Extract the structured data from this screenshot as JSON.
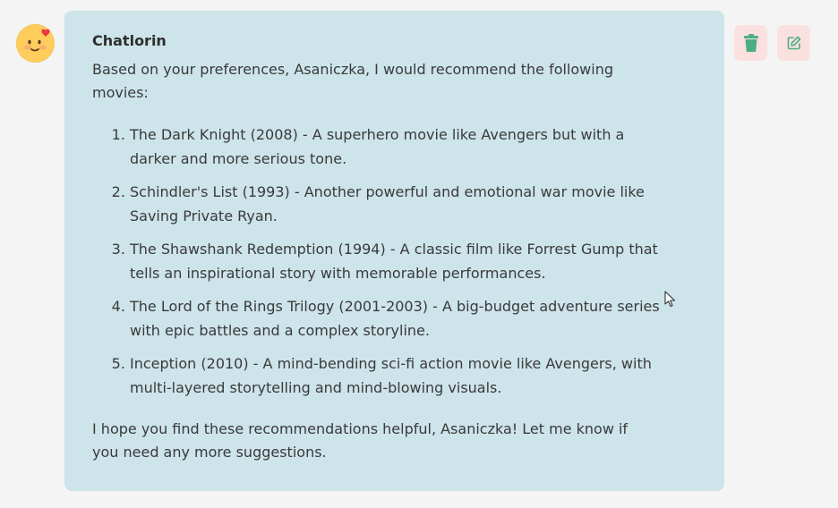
{
  "message": {
    "sender": "Chatlorin",
    "intro": "Based on your preferences, Asaniczka, I would recommend the following movies:",
    "recommendations": [
      "The Dark Knight (2008) - A superhero movie like Avengers but with a darker and more serious tone.",
      "Schindler's List (1993) - Another powerful and emotional war movie like Saving Private Ryan.",
      "The Shawshank Redemption (1994) - A classic film like Forrest Gump that tells an inspirational story with memorable performances.",
      "The Lord of the Rings Trilogy (2001-2003) - A big-budget adventure series with epic battles and a complex storyline.",
      "Inception (2010) - A mind-bending sci-fi action movie like Avengers, with multi-layered storytelling and mind-blowing visuals."
    ],
    "outro": "I hope you find these recommendations helpful, Asaniczka! Let me know if you need any more suggestions."
  },
  "avatar": {
    "icon": "smiling-face-with-hearts-emoji"
  },
  "actions": {
    "delete_icon": "trash-icon",
    "edit_icon": "edit-icon"
  },
  "colors": {
    "bubble_bg": "#cde4ea",
    "page_bg": "#f4f4f4",
    "action_bg": "#fbe0e0",
    "action_icon": "#4cae85"
  }
}
